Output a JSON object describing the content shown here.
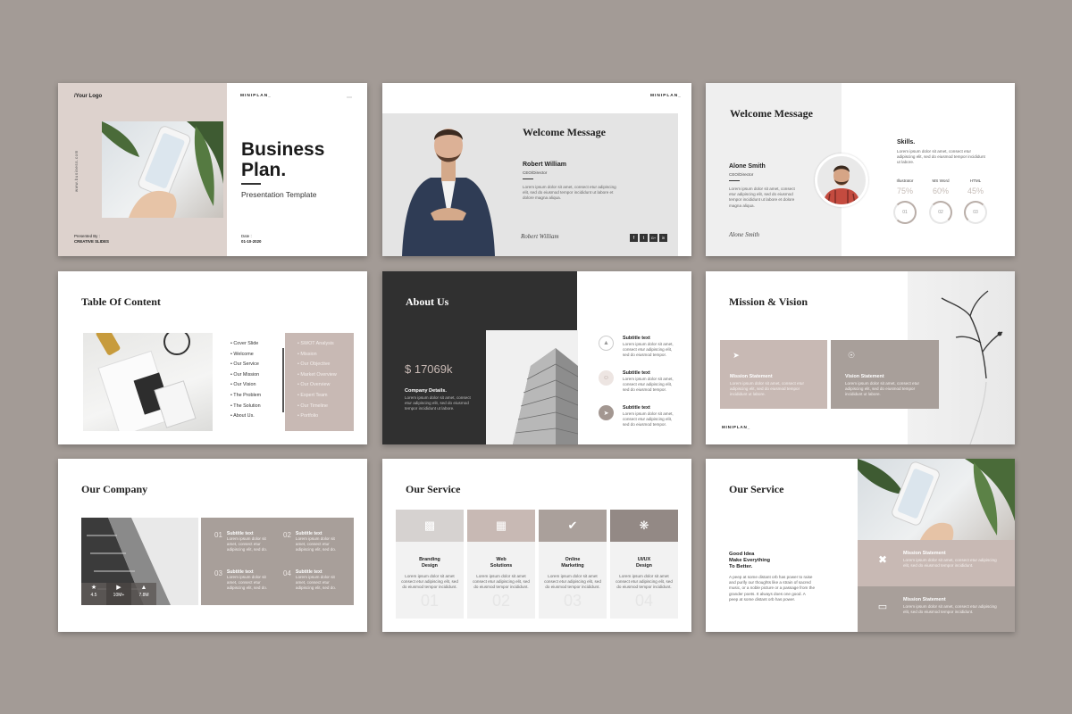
{
  "colors": {
    "background": "#a39b96",
    "taupe": "#c8b9b4",
    "taupe_dark": "#a89f9a",
    "charcoal": "#303030",
    "light_gray": "#e4e4e4"
  },
  "lorem_short": "Lorem ipsum dolor sit amet, consect etur adipiscing elit, sed do eiusmod tempor incididunt ut labore.",
  "lorem_three": "Lorem ipsum dolor sit amet consect etur adipiscing elit, sed do eiusmod tempor incididunt.",
  "slide1": {
    "logo": "/Your Logo",
    "brand": "MINIPLAN_",
    "website": "www.business.com",
    "title_line1": "Business",
    "title_line2": "Plan.",
    "subtitle": "Presentation Template",
    "presented_label": "Presented By :",
    "presented_name": "CREATIVE SLIDES",
    "date_label": "Date :",
    "date_value": "01-10-2020"
  },
  "slide2": {
    "brand": "MINIPLAN_",
    "title": "Welcome Message",
    "name": "Robert William",
    "role": "CEO/Director",
    "body": "Lorem ipsum dolor sit amet, consect etur adipiscing elit, sed do eiusmod tempor incididunt ut labore et dolore magna aliqua.",
    "signature": "Robert William",
    "social": [
      "f",
      "t",
      "G+",
      "in"
    ]
  },
  "slide3": {
    "title": "Welcome Message",
    "name": "Alone Smith",
    "role": "CEO/Director",
    "body": "Lorem ipsum dolor sit amet, consect etur adipiscing elit, sed do eiusmod tempor incididunt ut labore et dolore magna aliqua.",
    "signature": "Alone Smith",
    "skills_title": "Skills.",
    "skills_body": "Lorem ipsum dolor sit amet, consect etur adipiscing elit, sed do eiusmod tempor incididunt ut labore.",
    "skills": [
      {
        "name": "Illustrator",
        "value": "75%",
        "num": "01",
        "level": 0.75
      },
      {
        "name": "MS Word",
        "value": "60%",
        "num": "02",
        "level": 0.6
      },
      {
        "name": "HTML",
        "value": "45%",
        "num": "03",
        "level": 0.45
      }
    ]
  },
  "slide4": {
    "title": "Table Of Content",
    "left_items": [
      "Cover Slide",
      "Welcome",
      "Our Service",
      "Our Mission",
      "Our Vision",
      "The Problem",
      "The Solution",
      "About Us."
    ],
    "right_items": [
      "SWOT Analysis",
      "Mission",
      "Our Objective",
      "Market Overview",
      "Our Overview",
      "Expert Team",
      "Our Timeline",
      "Portfolio"
    ]
  },
  "slide5": {
    "title": "About Us",
    "amount": "$ 17069k",
    "company_title": "Company Details.",
    "company_body": "Lorem ipsum dolor sit amet, consect etur adipiscing elit, sed do eiusmod tempor incididunt ut labore.",
    "items": [
      {
        "title": "Subtitle text",
        "body": "Lorem ipsum dolor sit amet, consect etur adipiscing elit, sed do eiusmod tempor.",
        "icon": "rocket-icon"
      },
      {
        "title": "Subtitle text",
        "body": "Lorem ipsum dolor sit amet, consect etur adipiscing elit, sed do eiusmod tempor.",
        "icon": "user-icon"
      },
      {
        "title": "Subtitle text",
        "body": "Lorem ipsum dolor sit amet, consect etur adipiscing elit, sed do eiusmod tempor.",
        "icon": "launch-icon"
      }
    ]
  },
  "slide6": {
    "title": "Mission & Vision",
    "brand": "MINIPLAN_",
    "cards": [
      {
        "title": "Mission Statement",
        "body": "Lorem ipsum dolor sit amet, consect etur adipiscing elit, sed do eiusmod tempor incididunt ut labore.",
        "icon": "rocket-icon"
      },
      {
        "title": "Vision Statement",
        "body": "Lorem ipsum dolor sit amet, consect etur adipiscing elit, sed do eiusmod tempor incididunt ut labore.",
        "icon": "eye-icon"
      }
    ]
  },
  "slide7": {
    "title": "Our Company",
    "stats": [
      "4.5",
      "10M+",
      "7.8M"
    ],
    "items": [
      {
        "num": "01",
        "title": "Subtitle text",
        "body": "Lorem ipsum dolor sit amet, consect etur adipiscing elit, sed do."
      },
      {
        "num": "02",
        "title": "Subtitle text",
        "body": "Lorem ipsum dolor sit amet, consect etur adipiscing elit, sed do."
      },
      {
        "num": "03",
        "title": "Subtitle text",
        "body": "Lorem ipsum dolor sit amet, consect etur adipiscing elit, sed do."
      },
      {
        "num": "04",
        "title": "Subtitle text",
        "body": "Lorem ipsum dolor sit amet, consect etur adipiscing elit, sed do."
      }
    ]
  },
  "slide8": {
    "title": "Our Service",
    "services": [
      {
        "line1": "Branding",
        "line2": "Design",
        "num": "01",
        "icon": "chart-icon"
      },
      {
        "line1": "Web",
        "line2": "Solutions",
        "num": "02",
        "icon": "calendar-icon"
      },
      {
        "line1": "Online",
        "line2": "Marketing",
        "num": "03",
        "icon": "check-icon"
      },
      {
        "line1": "UI/UX",
        "line2": "Design",
        "num": "04",
        "icon": "bulb-icon"
      }
    ]
  },
  "slide9": {
    "title": "Our Service",
    "headline1": "Good Idea",
    "headline2": "Make Everything",
    "headline3": "To Better.",
    "body": "A peep at some distant orb has power to raise and purify our thoughts like a strain of sacred music, or a noble picture or a passage from the grander poets. It always does one good. A peep at some distant orb has power.",
    "cards": [
      {
        "title": "Mission Statement",
        "body": "Lorem ipsum dolor sit amet, consect etur adipiscing elit, sed do eiusmod tempor incididunt.",
        "icon": "tools-icon"
      },
      {
        "title": "Mission Statement",
        "body": "Lorem ipsum dolor sit amet, consect etur adipiscing elit, sed do eiusmod tempor incididunt.",
        "icon": "laptop-icon"
      }
    ]
  }
}
